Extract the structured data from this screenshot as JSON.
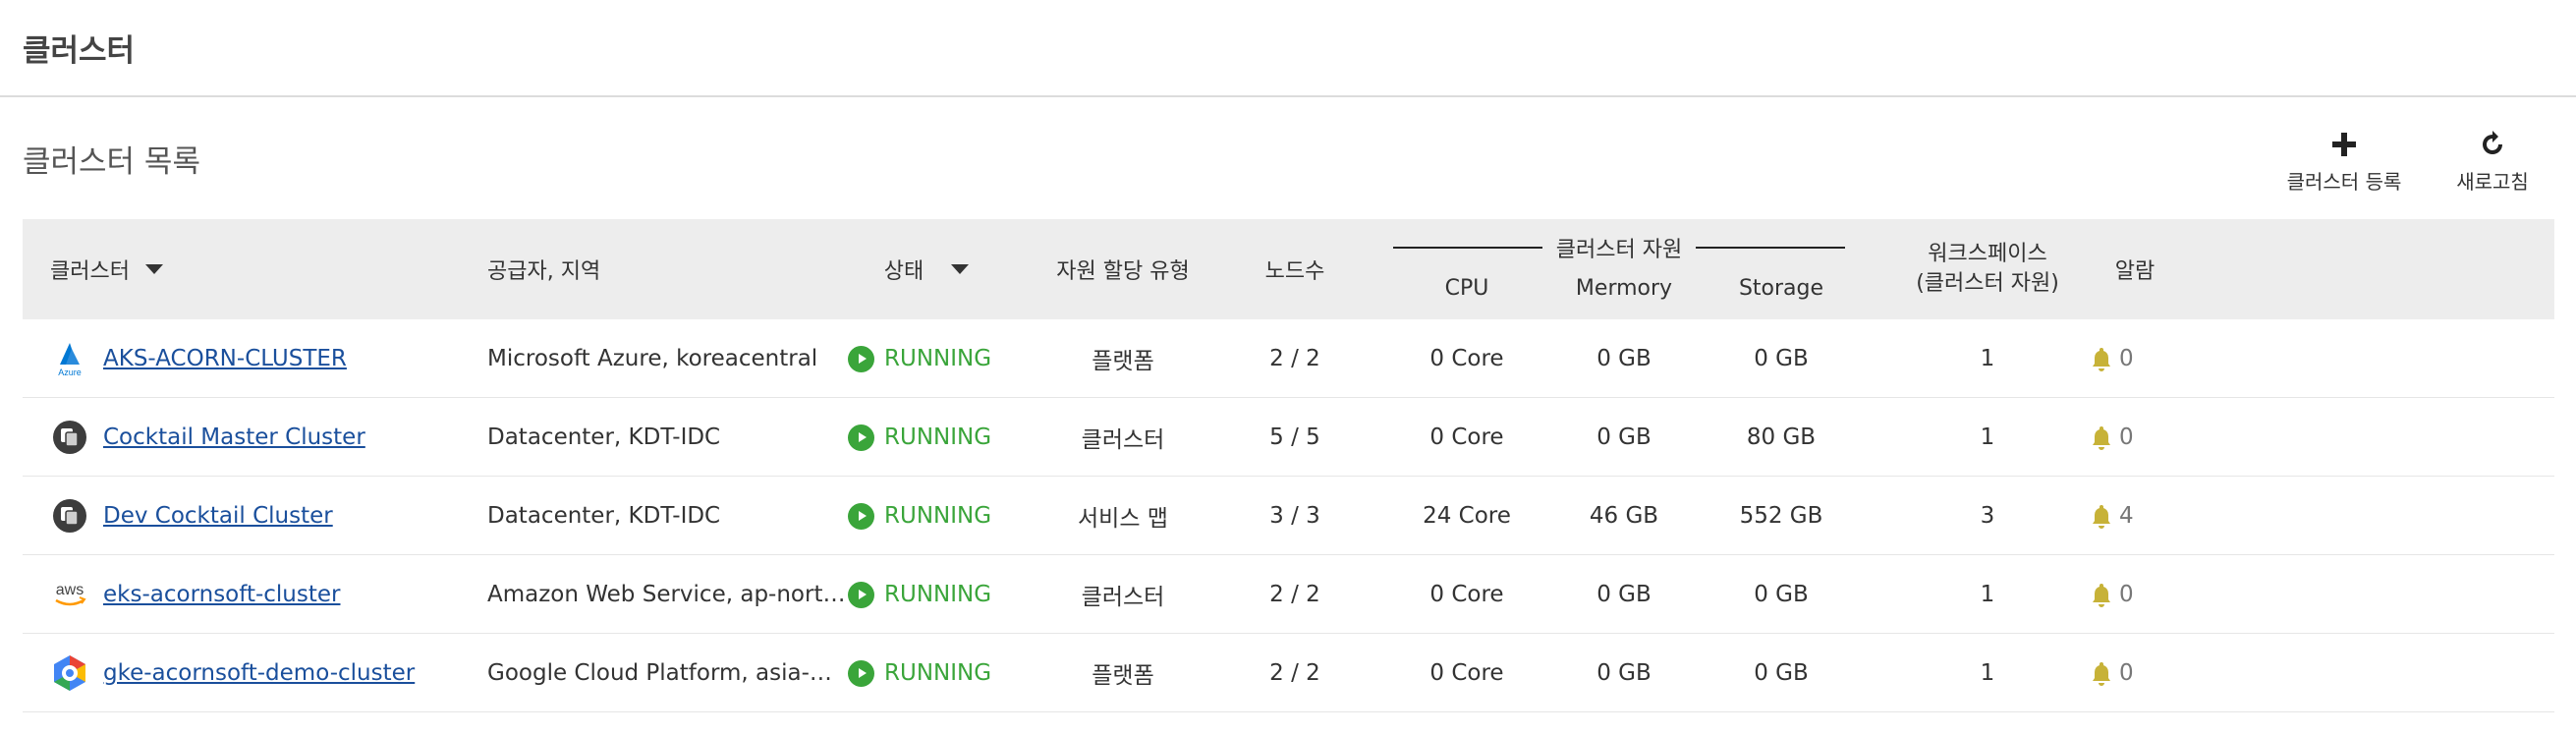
{
  "header": {
    "title": "클러스터"
  },
  "list": {
    "title": "클러스터 목록",
    "toolbar": {
      "add_label": "클러스터 등록",
      "refresh_label": "새로고침"
    }
  },
  "table": {
    "columns": {
      "cluster": "클러스터",
      "provider": "공급자, 지역",
      "status": "상태",
      "alloc_type": "자원 할당 유형",
      "nodes": "노드수",
      "resource_group": "클러스터 자원",
      "cpu": "CPU",
      "memory": "Mermory",
      "storage": "Storage",
      "workspace_line1": "워크스페이스",
      "workspace_line2": "(클러스터 자원)",
      "alarm": "알람"
    },
    "rows": [
      {
        "icon": "azure-icon",
        "name": "AKS-ACORN-CLUSTER",
        "provider": "Microsoft Azure, koreacentral",
        "status": "RUNNING",
        "alloc_type": "플랫폼",
        "nodes": "2 / 2",
        "cpu": "0 Core",
        "memory": "0 GB",
        "storage": "0 GB",
        "workspace": "1",
        "alarm": "0"
      },
      {
        "icon": "datacenter-icon",
        "name": "Cocktail Master Cluster",
        "provider": "Datacenter, KDT-IDC",
        "status": "RUNNING",
        "alloc_type": "클러스터",
        "nodes": "5 / 5",
        "cpu": "0 Core",
        "memory": "0 GB",
        "storage": "80 GB",
        "workspace": "1",
        "alarm": "0"
      },
      {
        "icon": "datacenter-icon",
        "name": "Dev Cocktail Cluster",
        "provider": "Datacenter, KDT-IDC",
        "status": "RUNNING",
        "alloc_type": "서비스 맵",
        "nodes": "3 / 3",
        "cpu": "24 Core",
        "memory": "46 GB",
        "storage": "552 GB",
        "workspace": "3",
        "alarm": "4"
      },
      {
        "icon": "aws-icon",
        "name": "eks-acornsoft-cluster",
        "provider": "Amazon Web Service, ap-nort…",
        "status": "RUNNING",
        "alloc_type": "클러스터",
        "nodes": "2 / 2",
        "cpu": "0 Core",
        "memory": "0 GB",
        "storage": "0 GB",
        "workspace": "1",
        "alarm": "0"
      },
      {
        "icon": "gcp-icon",
        "name": "gke-acornsoft-demo-cluster",
        "provider": "Google Cloud Platform, asia-n…",
        "status": "RUNNING",
        "alloc_type": "플랫폼",
        "nodes": "2 / 2",
        "cpu": "0 Core",
        "memory": "0 GB",
        "storage": "0 GB",
        "workspace": "1",
        "alarm": "0"
      }
    ]
  },
  "icons": {
    "azure_text": "Azure",
    "aws_text": "aws"
  },
  "colors": {
    "running": "#3aa53a",
    "link": "#1a4f9c",
    "bell": "#c7b238",
    "header_bg": "#ededed"
  }
}
